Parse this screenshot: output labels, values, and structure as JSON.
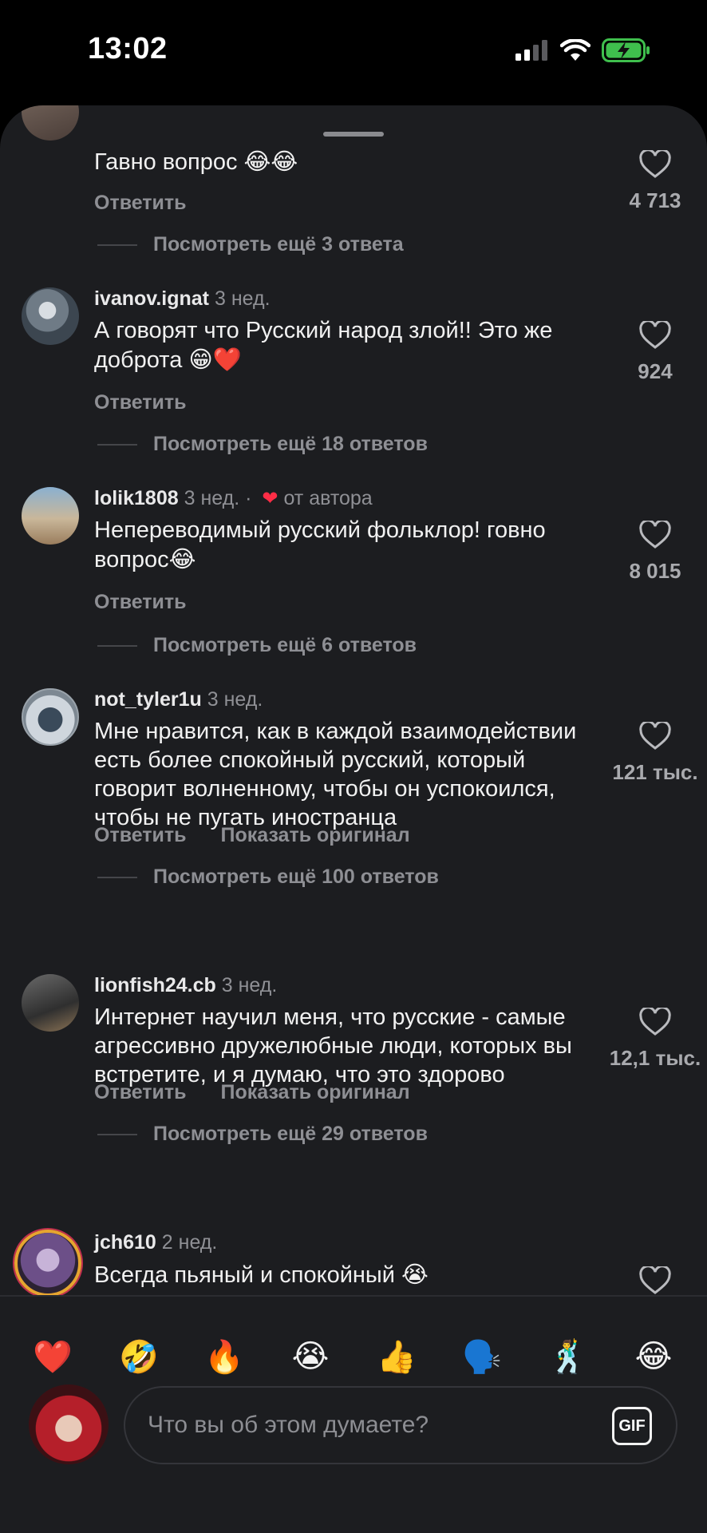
{
  "status_bar": {
    "time": "13:02"
  },
  "comments": [
    {
      "text": "Гавно вопрос",
      "emoji": "😂😂",
      "reply_label": "Ответить",
      "likes": "4 713",
      "more_replies": "Посмотреть ещё 3 ответа"
    },
    {
      "username": "ivanov.ignat",
      "age": "3 нед.",
      "text": "А говорят что Русский народ злой!! Это же доброта",
      "emoji": "😁❤️",
      "reply_label": "Ответить",
      "likes": "924",
      "more_replies": "Посмотреть ещё 18 ответов"
    },
    {
      "username": "lolik1808",
      "age": "3 нед. ·",
      "author_badge": "от автора",
      "text": "Непереводимый русский фольклор! говно вопрос",
      "emoji": "😂",
      "reply_label": "Ответить",
      "likes": "8 015",
      "more_replies": "Посмотреть ещё 6 ответов"
    },
    {
      "username": "not_tyler1u",
      "age": "3 нед.",
      "text": "Мне нравится, как в каждой взаимодействии есть более спокойный русский, который говорит волненному, чтобы он успокоился, чтобы не пугать иностранца",
      "reply_label": "Ответить",
      "original_label": "Показать оригинал",
      "likes": "121 тыс.",
      "more_replies": "Посмотреть ещё 100 ответов"
    },
    {
      "username": "lionfish24.cb",
      "age": "3 нед.",
      "text": "Интернет научил меня, что русские - самые агрессивно дружелюбные люди, которых вы встретите, и я думаю, что это здорово",
      "reply_label": "Ответить",
      "original_label": "Показать оригинал",
      "likes": "12,1 тыс.",
      "more_replies": "Посмотреть ещё 29 ответов"
    },
    {
      "username": "jch610",
      "age": "2 нед.",
      "text": "Всегда пьяный и спокойный",
      "emoji": "😭"
    }
  ],
  "emoji_bar": [
    "❤️",
    "🤣",
    "🔥",
    "😭",
    "👍",
    "🗣️",
    "🕺",
    "😂"
  ],
  "composer": {
    "placeholder": "Что вы об этом думаете?",
    "gif_label": "GIF"
  },
  "colors": {
    "background": "#1c1d20",
    "heart_red": "#ff2d46",
    "muted_text": "#8e8f94"
  }
}
